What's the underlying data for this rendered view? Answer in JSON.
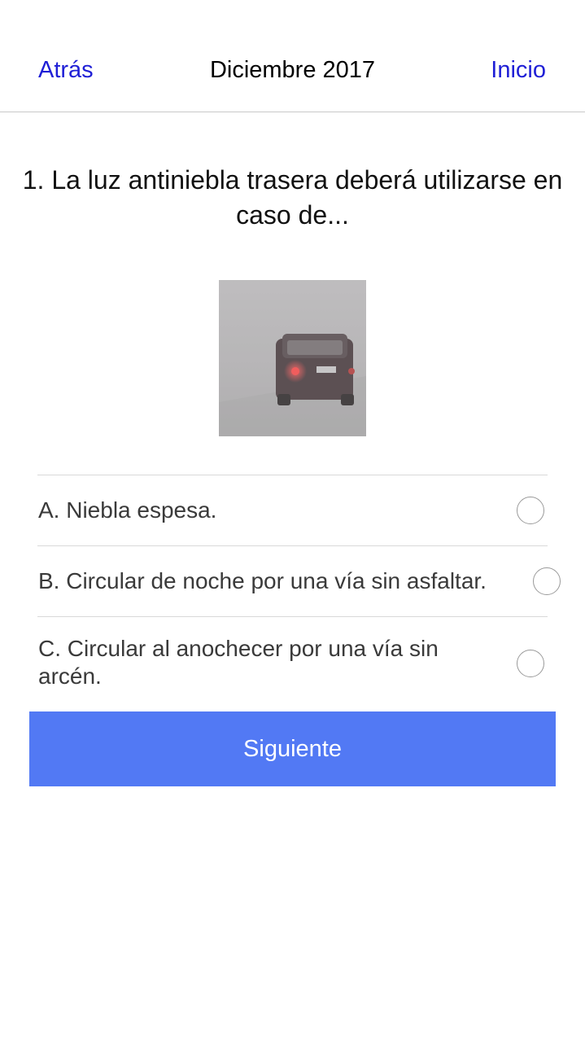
{
  "nav": {
    "back_label": "Atrás",
    "title": "Diciembre 2017",
    "home_label": "Inicio"
  },
  "question": {
    "text": "1. La luz antiniebla trasera deberá utilizarse en caso de..."
  },
  "options": [
    {
      "label": "A. Niebla espesa.",
      "selected": false
    },
    {
      "label": "B. Circular de noche por una vía sin asfaltar.",
      "selected": false
    },
    {
      "label": "C. Circular al anochecer por una vía sin arcén.",
      "selected": false
    }
  ],
  "next_button": {
    "label": "Siguiente"
  },
  "colors": {
    "link": "#1f1fd6",
    "button": "#5279f4"
  }
}
